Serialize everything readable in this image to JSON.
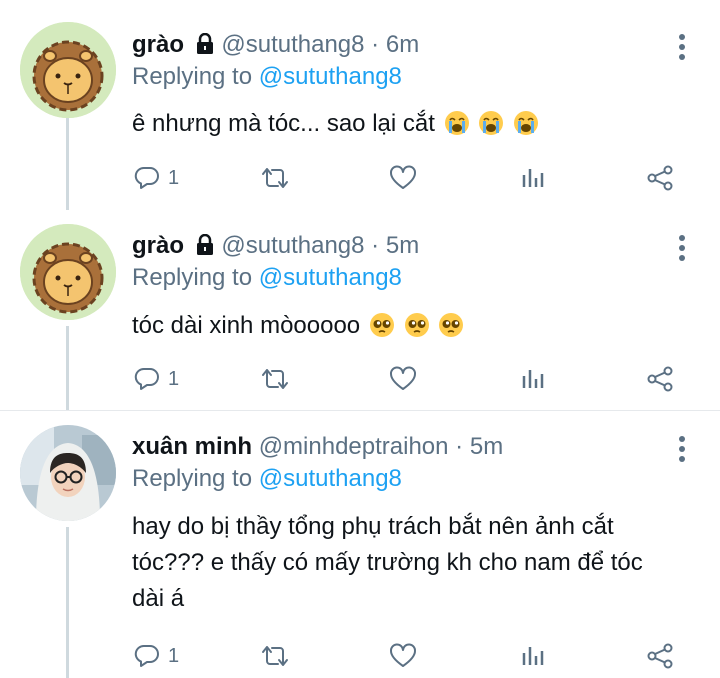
{
  "tweets": [
    {
      "name": "grào",
      "handle": "@sututhang8",
      "separator": "·",
      "time": "6m",
      "replying_prefix": "Replying to",
      "replying_to": "@sututhang8",
      "text": "ê nhưng mà tóc... sao lại cắt",
      "emojis": [
        "loudly-crying-face",
        "loudly-crying-face",
        "loudly-crying-face"
      ],
      "reply_count": "1",
      "avatar": "lion-cartoon-avatar"
    },
    {
      "name": "grào",
      "handle": "@sututhang8",
      "separator": "·",
      "time": "5m",
      "replying_prefix": "Replying to",
      "replying_to": "@sututhang8",
      "text": "tóc dài xinh mòooooo",
      "emojis": [
        "pleading-face",
        "pleading-face",
        "pleading-face"
      ],
      "reply_count": "1",
      "avatar": "lion-cartoon-avatar"
    },
    {
      "name": "xuân minh",
      "handle": "@minhdeptraihon",
      "separator": "·",
      "time": "5m",
      "replying_prefix": "Replying to",
      "replying_to": "@sututhang8",
      "text_line1": "hay do bị thầy tổng phụ trách bắt nên ảnh cắt",
      "text_line2": "tóc??? e thấy có mấy trường kh cho nam để tóc",
      "text_line3": "dài á",
      "reply_count": "1",
      "avatar": "person-photo-avatar"
    }
  ],
  "icons": {
    "reply": "reply-icon",
    "retweet": "retweet-icon",
    "like": "heart-icon",
    "analytics": "analytics-icon",
    "share": "share-icon",
    "more": "more-vertical-icon",
    "lock": "lock-icon"
  },
  "colors": {
    "link": "#1da1f2",
    "secondary": "#5b7083",
    "thread_line": "#cfd9de"
  }
}
